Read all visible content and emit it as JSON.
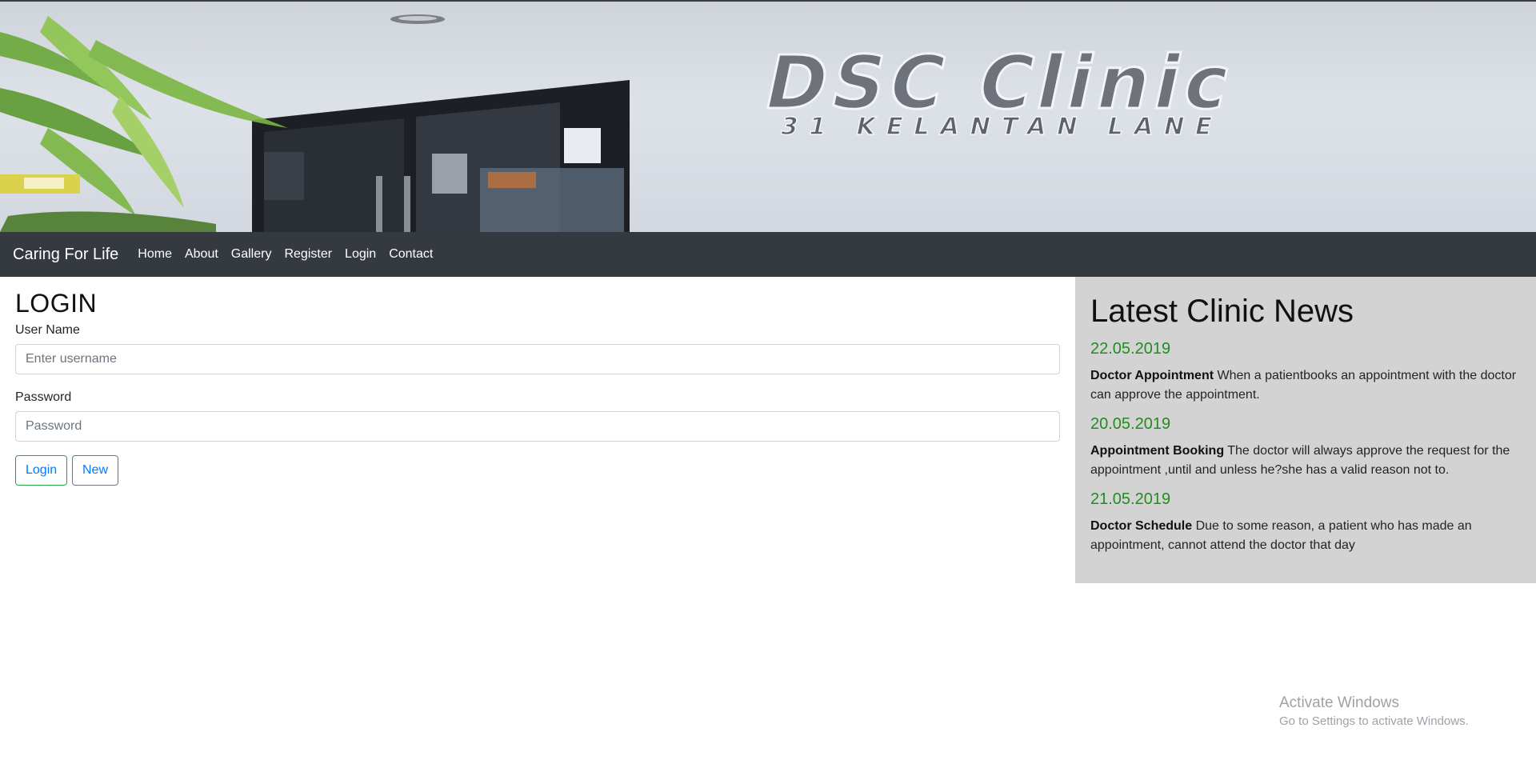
{
  "banner": {
    "clinic_name": "DSC Clinic",
    "clinic_address": "31 KELANTAN LANE"
  },
  "navbar": {
    "brand": "Caring For Life",
    "links": [
      "Home",
      "About",
      "Gallery",
      "Register",
      "Login",
      "Contact"
    ]
  },
  "login": {
    "title": "LOGIN",
    "username_label": "User Name",
    "username_placeholder": "Enter username",
    "password_label": "Password",
    "password_placeholder": "Password",
    "login_button": "Login",
    "new_button": "New"
  },
  "news": {
    "title": "Latest Clinic News",
    "items": [
      {
        "date": "22.05.2019",
        "heading": "Doctor Appointment",
        "body": " When a patientbooks an appointment with the doctor can approve the appointment."
      },
      {
        "date": "20.05.2019",
        "heading": "Appointment Booking",
        "body": " The doctor will always approve the request for the appointment ,until and unless he?she has a valid reason not to."
      },
      {
        "date": "21.05.2019",
        "heading": "Doctor Schedule",
        "body": " Due to some reason, a patient who has made an appointment, cannot attend the doctor that day"
      }
    ]
  },
  "watermark": {
    "line1": "Activate Windows",
    "line2": "Go to Settings to activate Windows."
  },
  "colors": {
    "navbar_bg": "#343a40",
    "news_bg": "#d3d3d3",
    "news_date": "#228b22",
    "link_blue": "#007bff",
    "success_green": "#28a745"
  }
}
